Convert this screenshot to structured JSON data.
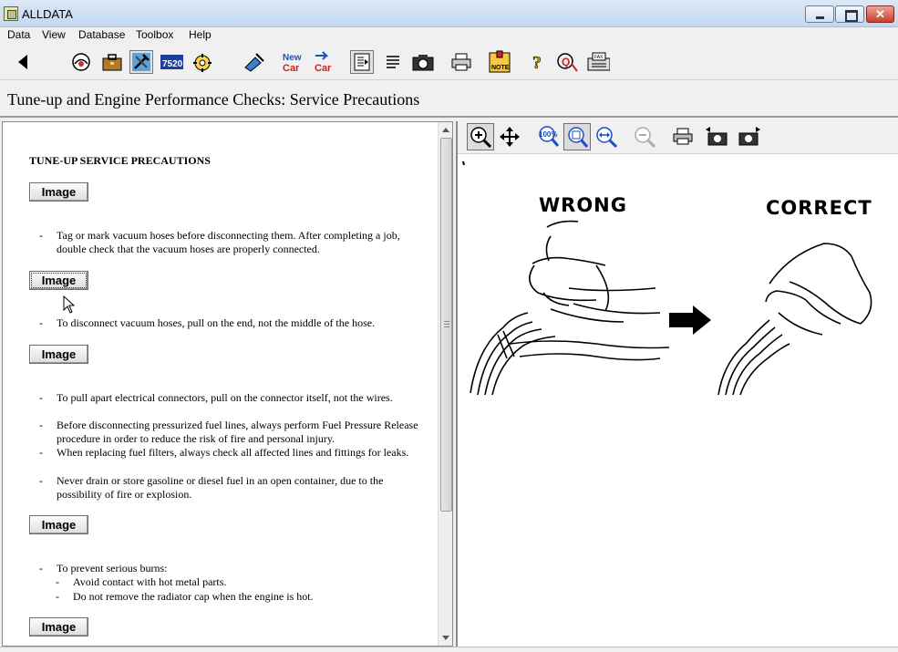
{
  "window": {
    "title": "ALLDATA",
    "controls": [
      "minimize",
      "maximize",
      "close"
    ]
  },
  "menu": [
    "Data",
    "View",
    "Database",
    "Toolbox",
    "Help"
  ],
  "toolbar": {
    "icons": [
      "back-arrow-icon",
      "vehicle-select-icon",
      "briefcase-icon",
      "repair-tools-icon",
      "tsb-icon",
      "engine-icon",
      "parts-icon",
      "new-car-icon",
      "car-icon",
      "document-view-icon",
      "list-icon",
      "camera-icon",
      "print-icon",
      "note-icon",
      "help-icon",
      "whats-new-icon",
      "fax-icon"
    ],
    "new_car_label": "New\nCar",
    "car_label": "Car",
    "note_label": "NOTE",
    "fax_label": "FAX"
  },
  "page": {
    "title": "Tune-up and Engine Performance Checks:  Service Precautions"
  },
  "document": {
    "heading": "TUNE-UP SERVICE PRECAUTIONS",
    "image_button_label": "Image",
    "bullets": [
      "Tag or mark vacuum hoses before disconnecting them. After completing a job, double check that the vacuum hoses are properly connected.",
      "To disconnect vacuum hoses, pull on the end, not the middle of the hose.",
      "To pull apart electrical connectors, pull on the connector itself, not the wires.",
      "Before disconnecting pressurized fuel lines, always perform Fuel Pressure Release procedure in order to reduce the risk of fire and personal injury.",
      "When replacing fuel filters, always check all affected lines and fittings for leaks.",
      "Never drain or store gasoline or diesel fuel in an open container, due to the possibility of fire or explosion.",
      "To prevent serious burns:",
      "Avoid contact with hot metal parts.",
      "Do not remove the radiator cap when the engine is hot."
    ],
    "dash": "-"
  },
  "image_viewer": {
    "toolbar_icons": [
      "zoom-in-icon",
      "pan-icon",
      "zoom-100-icon",
      "fit-window-icon",
      "fit-width-icon",
      "zoom-out-icon",
      "print-icon",
      "prev-image-icon",
      "next-image-icon"
    ],
    "zoom_100_label": "100%",
    "label_wrong": "WRONG",
    "label_correct": "CORRECT"
  }
}
